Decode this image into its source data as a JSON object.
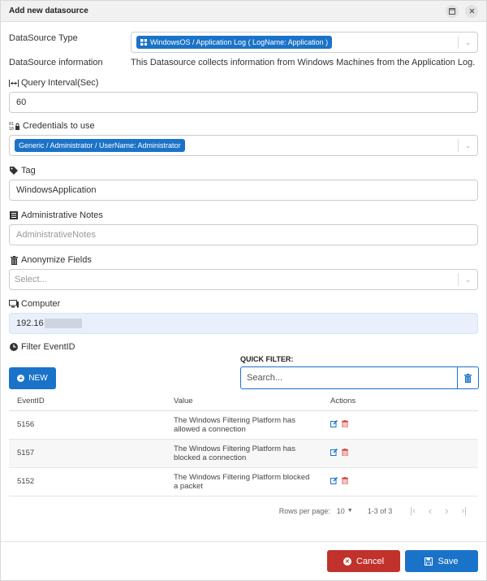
{
  "dialog": {
    "title": "Add new datasource"
  },
  "datasource_type": {
    "label": "DataSource Type",
    "selected": "WindowsOS / Application Log ( LogName: Application )"
  },
  "datasource_info": {
    "label": "DataSource information",
    "text": "This Datasource collects information from Windows Machines from the Application Log."
  },
  "query_interval": {
    "label": "Query Interval(Sec)",
    "value": "60"
  },
  "credentials": {
    "label": "Credentials to use",
    "selected": "Generic / Administrator / UserName: Administrator"
  },
  "tag": {
    "label": "Tag",
    "value": "WindowsApplication"
  },
  "admin_notes": {
    "label": "Administrative Notes",
    "placeholder": "AdministrativeNotes"
  },
  "anonymize": {
    "label": "Anonymize Fields",
    "placeholder": "Select..."
  },
  "computer": {
    "label": "Computer",
    "value": "192.16"
  },
  "filter": {
    "label": "Filter EventID",
    "quick_filter_label": "QUICK FILTER:",
    "search_placeholder": "Search...",
    "new_label": "NEW",
    "columns": [
      "EventID",
      "Value",
      "Actions"
    ],
    "rows": [
      {
        "id": "5156",
        "value_line1": "The Windows Filtering Platform has",
        "value_line2": "allowed a connection"
      },
      {
        "id": "5157",
        "value_line1": "The Windows Filtering Platform has",
        "value_line2": "blocked a connection"
      },
      {
        "id": "5152",
        "value_line1": "The Windows Filtering Platform blocked",
        "value_line2": "a packet"
      }
    ],
    "rows_per_page_label": "Rows per page:",
    "rows_per_page": "10",
    "range": "1-3 of 3"
  },
  "footer": {
    "cancel_label": "Cancel",
    "save_label": "Save"
  },
  "colors": {
    "primary": "#1a73c8",
    "danger": "#c0322b"
  }
}
